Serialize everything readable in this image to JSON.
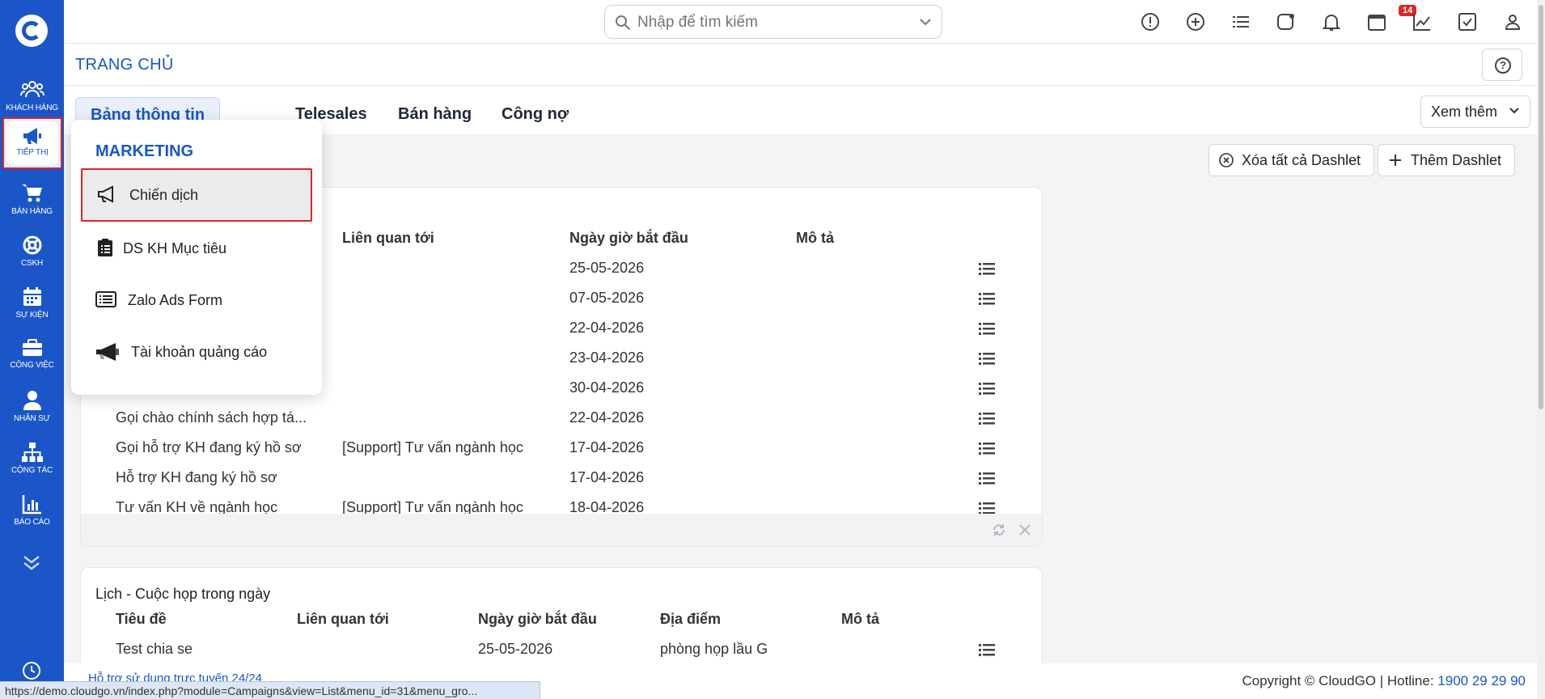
{
  "sidebar": {
    "items": [
      {
        "label": "KHÁCH HÀNG",
        "icon": "users-icon"
      },
      {
        "label": "TIẾP THỊ",
        "icon": "megaphone-icon"
      },
      {
        "label": "BÁN HÀNG",
        "icon": "cart-icon"
      },
      {
        "label": "CSKH",
        "icon": "lifebuoy-icon"
      },
      {
        "label": "SỰ KIỆN",
        "icon": "calendar-icon"
      },
      {
        "label": "CÔNG VIỆC",
        "icon": "briefcase-icon"
      },
      {
        "label": "NHÂN SỰ",
        "icon": "person-icon"
      },
      {
        "label": "CỘNG TÁC",
        "icon": "sitemap-icon"
      },
      {
        "label": "BÁO CÁO",
        "icon": "bar-chart-icon"
      }
    ]
  },
  "topbar": {
    "search_placeholder": "Nhập để tìm kiếm",
    "notification_count": "14"
  },
  "page": {
    "title": "TRANG CHỦ",
    "help": "?"
  },
  "tabs": [
    "Bảng thông tin",
    "Telesales",
    "Bán hàng",
    "Công nợ"
  ],
  "more_label": "Xem thêm",
  "buttons": {
    "clear_dashlets": "Xóa tất cả Dashlet",
    "add_dashlet": "Thêm Dashlet"
  },
  "menu": {
    "heading": "MARKETING",
    "items": [
      "Chiến dịch",
      "DS KH Mục tiêu",
      "Zalo Ads Form",
      "Tài khoản quảng cáo"
    ]
  },
  "dashlet1": {
    "columns": [
      "Liên quan tới",
      "Ngày giờ bắt đầu",
      "Mô tả"
    ],
    "rows": [
      {
        "title": "",
        "related": "",
        "date": "25-05-2026"
      },
      {
        "title": "",
        "related": "",
        "date": "07-05-2026"
      },
      {
        "title": "",
        "related": "",
        "date": "22-04-2026"
      },
      {
        "title": "",
        "related": "",
        "date": "23-04-2026"
      },
      {
        "title": "",
        "related": "",
        "date": "30-04-2026"
      },
      {
        "title": "Gọi chào chính sách hợp tá...",
        "related": "",
        "date": "22-04-2026"
      },
      {
        "title": "Gọi hỗ trợ KH đang ký hồ sơ",
        "related": "[Support] Tư vấn ngành học",
        "date": "17-04-2026"
      },
      {
        "title": "Hỗ trợ KH đang ký hồ sơ",
        "related": "",
        "date": "17-04-2026"
      },
      {
        "title": "Tư vấn KH về ngành học",
        "related": "[Support] Tư vấn ngành học",
        "date": "18-04-2026"
      }
    ]
  },
  "dashlet2": {
    "title": "Lịch - Cuộc họp trong ngày",
    "columns": [
      "Tiêu đề",
      "Liên quan tới",
      "Ngày giờ bắt đầu",
      "Địa điểm",
      "Mô tả"
    ],
    "rows": [
      {
        "title": "Test chia se",
        "related": "",
        "date": "25-05-2026",
        "place": "phòng họp lầu G"
      }
    ]
  },
  "footer": {
    "copyright": "Copyright © CloudGO",
    "hotline_label": "Hotline:",
    "hotline": "1900 29 29 90",
    "support": "Hỗ trợ sử dụng trực tuyến 24/24",
    "status_url": "https://demo.cloudgo.vn/index.php?module=Campaigns&view=List&menu_id=31&menu_gro..."
  }
}
